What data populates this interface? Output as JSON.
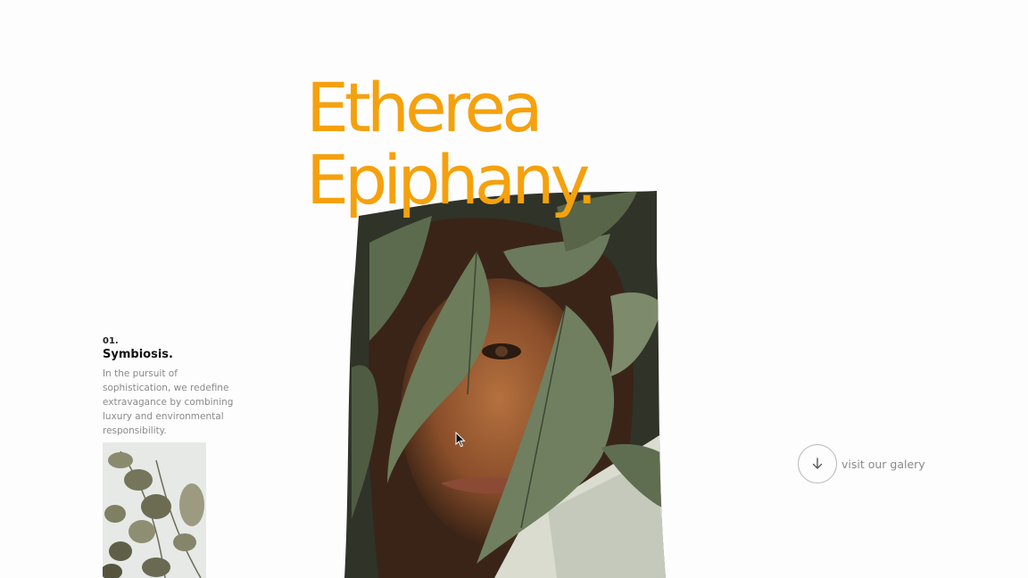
{
  "hero": {
    "title_line1": "Etherea",
    "title_line2": "Epiphany."
  },
  "feature": {
    "number": "01.",
    "title": "Symbiosis.",
    "description": "In the pursuit of sophistication, we redefine extravagance by combining luxury and environmental responsibility."
  },
  "gallery_link": {
    "label": "visit our galery",
    "icon": "arrow-down-icon"
  },
  "colors": {
    "accent": "#f5a10d",
    "text_dark": "#111111",
    "text_muted": "#8a8a8a",
    "background": "#fdfdfd"
  }
}
